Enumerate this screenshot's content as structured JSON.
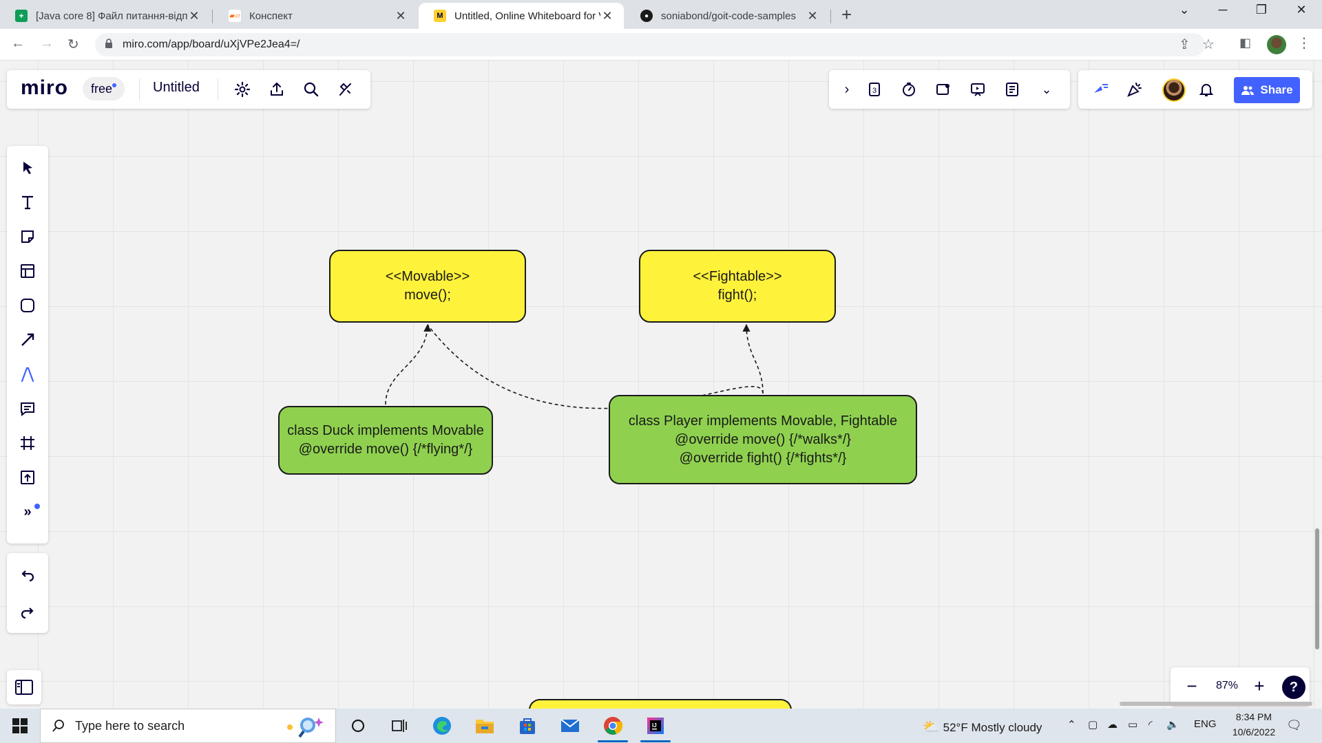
{
  "browser": {
    "tabs": [
      {
        "title": "[Java core 8] Файл питання-відп",
        "favicon": "sheets-icon",
        "color": "#0f9d58",
        "active": false
      },
      {
        "title": "Конспект",
        "favicon": "goit-icon",
        "color": "#ff6b0a",
        "active": false
      },
      {
        "title": "Untitled, Online Whiteboard for V",
        "favicon": "miro-icon",
        "color": "#ffd02f",
        "active": true
      },
      {
        "title": "soniabond/goit-code-samples",
        "favicon": "github-icon",
        "color": "#1a1a1a",
        "active": false
      }
    ],
    "new_tab": "+",
    "url": "miro.com/app/board/uXjVPe2Jea4=/"
  },
  "miro": {
    "logo": "miro",
    "plan": "free",
    "board_title": "Untitled",
    "share_label": "Share",
    "zoom_level": "87%",
    "zoom_out": "−",
    "zoom_in": "+",
    "help": "?",
    "accent_color": "#4262ff"
  },
  "board": {
    "movable": {
      "line1": "<<Movable>>",
      "line2": "move();"
    },
    "fightable": {
      "line1": "<<Fightable>>",
      "line2": "fight();"
    },
    "duck": {
      "line1": "class Duck implements Movable",
      "line2": "@override move() {/*flying*/}"
    },
    "player": {
      "line1": "class Player implements Movable, Fightable",
      "line2": "@override move() {/*walks*/}",
      "line3": "@override fight() {/*fights*/}"
    },
    "colors": {
      "yellow": "#fff23b",
      "green": "#8fd14f"
    }
  },
  "taskbar": {
    "search_placeholder": "Type here to search",
    "weather": "52°F  Mostly cloudy",
    "language": "ENG",
    "time": "8:34 PM",
    "date": "10/6/2022"
  }
}
